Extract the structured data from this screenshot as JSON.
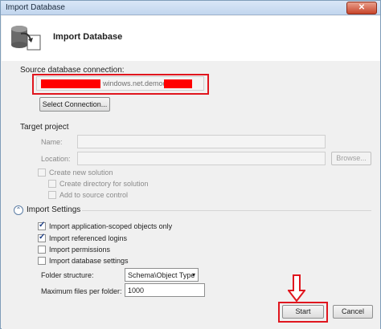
{
  "window": {
    "title": "Import Database",
    "close_glyph": "✕"
  },
  "header": {
    "title": "Import Database",
    "icon": "database-import-icon"
  },
  "source": {
    "label": "Source database connection:",
    "connection_text": "windows.net.demodb",
    "select_button": "Select Connection..."
  },
  "target": {
    "label": "Target project",
    "name_label": "Name:",
    "name_value": "",
    "location_label": "Location:",
    "location_value": "",
    "browse_button": "Browse...",
    "create_solution": "Create new solution",
    "create_directory": "Create directory for solution",
    "add_source_control": "Add to source control"
  },
  "import_settings": {
    "label": "Import Settings",
    "collapse_glyph": "⌃",
    "options": [
      {
        "label": "Import application-scoped objects only",
        "checked": true
      },
      {
        "label": "Import referenced logins",
        "checked": true
      },
      {
        "label": "Import permissions",
        "checked": false
      },
      {
        "label": "Import database settings",
        "checked": false
      }
    ],
    "folder_structure_label": "Folder structure:",
    "folder_structure_value": "Schema\\Object Type",
    "max_files_label": "Maximum files per folder:",
    "max_files_value": "1000"
  },
  "buttons": {
    "start": "Start",
    "cancel": "Cancel"
  },
  "colors": {
    "highlight": "#e0161e",
    "redaction": "#ff0000",
    "accent": "#2b4f7d"
  }
}
